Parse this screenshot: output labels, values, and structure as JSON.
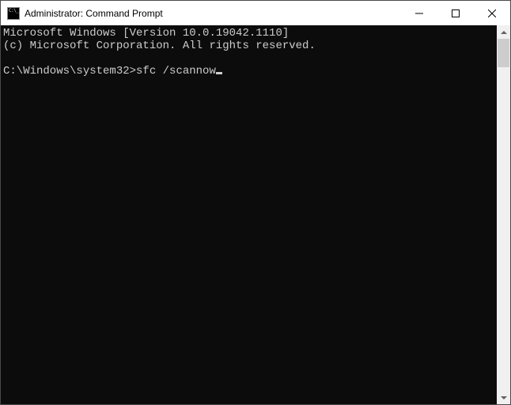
{
  "window": {
    "title": "Administrator: Command Prompt"
  },
  "terminal": {
    "line1": "Microsoft Windows [Version 10.0.19042.1110]",
    "line2": "(c) Microsoft Corporation. All rights reserved.",
    "blank": "",
    "prompt": "C:\\Windows\\system32>",
    "command": "sfc /scannow"
  }
}
